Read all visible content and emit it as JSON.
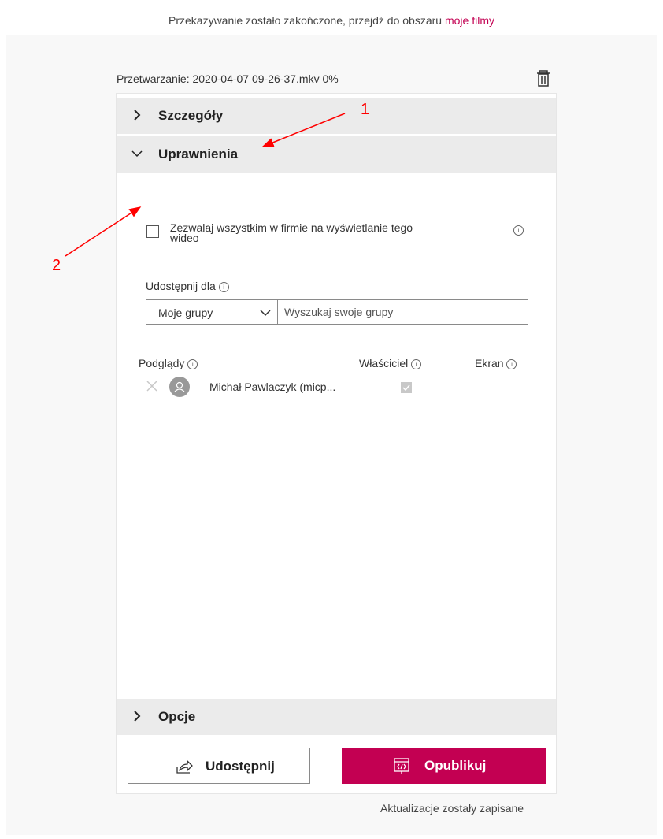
{
  "top_message": {
    "text": "Przekazywanie zostało zakończone, przejdź do obszaru ",
    "link": "moje filmy"
  },
  "processing": {
    "text": "Przetwarzanie: 2020-04-07 09-26-37.mkv 0%",
    "delete_icon": "trash-icon"
  },
  "sections": {
    "details": {
      "label": "Szczegóły",
      "state": "collapsed"
    },
    "permissions": {
      "label": "Uprawnienia",
      "state": "expanded"
    },
    "options": {
      "label": "Opcje",
      "state": "collapsed"
    }
  },
  "permissions": {
    "allow_company_label": "Zezwalaj wszystkim w firmie na wyświetlanie tego wideo",
    "allow_company_checked": false,
    "share_with_label": "Udostępnij dla",
    "group_dropdown": "Moje grupy",
    "search_placeholder": "Wyszukaj swoje grupy",
    "columns": {
      "viewers": "Podglądy",
      "owner": "Właściciel",
      "screen": "Ekran"
    },
    "people": [
      {
        "name": "Michał Pawlaczyk (micp...",
        "owner": true
      }
    ]
  },
  "actions": {
    "share_label": "Udostępnij",
    "publish_label": "Opublikuj"
  },
  "status": "Aktualizacje zostały zapisane",
  "annotations": [
    "1",
    "2"
  ],
  "colors": {
    "accent": "#c30052",
    "annotation": "#ff0000",
    "section_bg": "#ebebeb"
  }
}
